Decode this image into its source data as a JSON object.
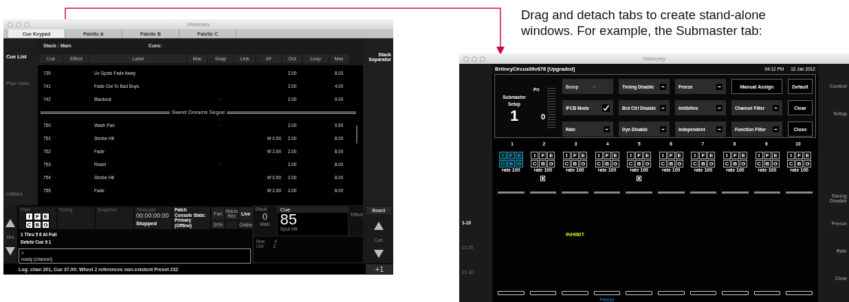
{
  "annotation": {
    "text": "Drag and detach tabs to create stand-alone windows. For example, the Submaster tab:"
  },
  "main_window": {
    "title": "Visionary",
    "tabs": [
      {
        "label": "Cue Keypad",
        "selected": true
      },
      {
        "label": "Palette A",
        "selected": false
      },
      {
        "label": "Palette B",
        "selected": false
      },
      {
        "label": "Palette C",
        "selected": false
      }
    ],
    "sidebar": [
      {
        "label": "Cue List",
        "selected": true
      },
      {
        "label": "Plan View",
        "selected": false
      },
      {
        "label": "Utilities",
        "selected": false
      }
    ],
    "stack_label": "Stack : Main",
    "cues_label": "Cues:",
    "right_label": "Stack Separator",
    "columns": [
      "Cue",
      "Effect",
      "Label",
      "Mac",
      "Snap",
      "Link",
      "AF",
      "Out",
      "Loop",
      "Max"
    ],
    "rows": [
      {
        "kind": "cue",
        "cue": "735",
        "label": "Uv Spots Fade Away",
        "out": "2.00",
        "max": "8.00"
      },
      {
        "kind": "cue",
        "cue": "741",
        "label": "Fade Out To Bad Boys",
        "out": "2.00",
        "max": "4.00"
      },
      {
        "kind": "cue",
        "cue": "742",
        "label": "Blackout",
        "snap": "·",
        "out": "2.00",
        "max": "9.00"
      },
      {
        "kind": "separator",
        "title": "Sweet Dreams Segue"
      },
      {
        "kind": "cue",
        "cue": "750",
        "label": "Wash Pan",
        "snap": "·",
        "out": "2.00",
        "max": "9.50"
      },
      {
        "kind": "cue",
        "cue": "751",
        "label": "Strobe Hit",
        "af": "W 0.50",
        "out": "2.00",
        "max": "8.00"
      },
      {
        "kind": "cue",
        "cue": "752",
        "label": "Fade",
        "af": "W 2.60",
        "out": "2.00",
        "max": "8.00"
      },
      {
        "kind": "cue",
        "cue": "753",
        "label": "Reset",
        "snap": "·",
        "out": "2.00",
        "max": "8.00"
      },
      {
        "kind": "cue",
        "cue": "754",
        "label": "Strobe Hit",
        "af": "W 0.50",
        "out": "2.00",
        "max": "8.00"
      },
      {
        "kind": "cue",
        "cue": "755",
        "label": "Fade",
        "af": "W 2.60",
        "out": "2.00",
        "max": "8.00"
      }
    ],
    "bottom": {
      "history_label": "Hist",
      "tiles": [
        {
          "kind": "filter",
          "label": "Filter",
          "flags": [
            "I",
            "F",
            "E",
            "C",
            "B",
            "G"
          ]
        },
        {
          "kind": "plain",
          "label": "Timing"
        },
        {
          "kind": "plain",
          "label": "Snapshot"
        },
        {
          "kind": "timecode",
          "label": "Timecode",
          "value": "00:00:00:00",
          "status": "Stopped"
        },
        {
          "kind": "patch",
          "lines": [
            "Patch",
            "Console State:",
            "Primary",
            "(Offline)"
          ]
        }
      ],
      "mode_buttons": [
        {
          "kind": "button",
          "label": "Part",
          "selected": false
        },
        {
          "kind": "button",
          "label": "Macro Rec",
          "selected": false
        },
        {
          "kind": "button",
          "label": "Live",
          "selected": true
        },
        {
          "kind": "button",
          "label": "SFth",
          "selected": false
        },
        {
          "kind": "blank"
        },
        {
          "kind": "button",
          "label": "Online",
          "selected": false
        }
      ],
      "history": [
        "1 Thru 5 6 At Full",
        "Delete Cue 9 1"
      ],
      "command": {
        "prompt": ">",
        "value": "ready (channel)"
      },
      "stack": {
        "label": "Stack",
        "value": "0",
        "name": "Main"
      },
      "cue": {
        "label": "Cue",
        "value": "85",
        "name": "Spot Hit"
      },
      "effect": {
        "label": "Effect"
      },
      "counts": [
        {
          "label": "Max",
          "value": "4"
        },
        {
          "label": "Out",
          "value": "2"
        }
      ],
      "board": {
        "label": "Board",
        "cue_label": "Cue"
      },
      "log": "Log: chan 201, Cue 37.00: Wheel 2 references non-existent Preset 232",
      "plus_button": "+1"
    }
  },
  "submaster_window": {
    "title": "Visionary",
    "show": "BritneyCircus09v676 [Upgraded]",
    "time": "04:12 PM",
    "date": "12 Jan 2012",
    "pages": [
      {
        "label": "1-10",
        "selected": true
      },
      {
        "label": "11-20",
        "selected": false
      },
      {
        "label": "21-30",
        "selected": false
      }
    ],
    "actions": [
      "Control",
      "Setup",
      "Timing Disable",
      "Freeze",
      "Rate",
      "Clear"
    ],
    "setup": {
      "title": "Submaster Setup",
      "number": "1",
      "priority_label": "Pri",
      "priority_value": "0",
      "controls": [
        {
          "kind": "toggle",
          "label": "Bump",
          "checked": false,
          "disabled": true
        },
        {
          "kind": "toggle",
          "label": "Timing Disable",
          "checked": false,
          "disabled": false
        },
        {
          "kind": "toggle",
          "label": "Freeze",
          "checked": false,
          "disabled": false
        },
        {
          "kind": "button",
          "label": "Manual Assign"
        },
        {
          "kind": "button",
          "label": "Default"
        },
        {
          "kind": "toggle",
          "label": "IFCB Mode",
          "checked": true,
          "disabled": false
        },
        {
          "kind": "toggle",
          "label": "Brd Ctrl Disable",
          "checked": false,
          "disabled": false
        },
        {
          "kind": "toggle",
          "label": "Inhibitive",
          "checked": false,
          "disabled": false
        },
        {
          "kind": "toggle",
          "label": "Channel Filter",
          "checked": false,
          "disabled": false
        },
        {
          "kind": "button",
          "label": "Clear"
        },
        {
          "kind": "toggle",
          "label": "Rate",
          "checked": false,
          "disabled": false
        },
        {
          "kind": "toggle",
          "label": "Dyn Disable",
          "checked": false,
          "disabled": false
        },
        {
          "kind": "toggle",
          "label": "Independent",
          "checked": false,
          "disabled": false
        },
        {
          "kind": "toggle",
          "label": "Function Filter",
          "checked": false,
          "disabled": false
        },
        {
          "kind": "button",
          "label": "Close"
        }
      ]
    },
    "submasters": [
      {
        "number": "1",
        "flags": [
          "I",
          "F",
          "E",
          "C",
          "B",
          "G"
        ],
        "selected": true,
        "rate": "rate 100",
        "marker": false
      },
      {
        "number": "2",
        "flags": [
          "I",
          "F",
          "E",
          "C",
          "B",
          "G"
        ],
        "selected": false,
        "rate": "rate 100",
        "marker": true
      },
      {
        "number": "3",
        "flags": [
          "I",
          "F",
          "E",
          "C",
          "B",
          "G"
        ],
        "selected": false,
        "rate": "rate 100",
        "marker": false,
        "status": "INHIBIT"
      },
      {
        "number": "4",
        "flags": [
          "I",
          "F",
          "E",
          "C",
          "B",
          "G"
        ],
        "selected": false,
        "rate": "rate 100",
        "marker": false,
        "footer": "Freeze"
      },
      {
        "number": "5",
        "flags": [
          "I",
          "F",
          "E",
          "C",
          "B",
          "G"
        ],
        "selected": false,
        "rate": "rate 100",
        "marker": true
      },
      {
        "number": "6",
        "flags": [
          "I",
          "F",
          "E",
          "C",
          "B",
          "G"
        ],
        "selected": false,
        "rate": "rate 100",
        "marker": false
      },
      {
        "number": "7",
        "flags": [
          "I",
          "F",
          "E",
          "C",
          "B",
          "G"
        ],
        "selected": false,
        "rate": "rate 100",
        "marker": false
      },
      {
        "number": "8",
        "flags": [
          "I",
          "F",
          "E",
          "C",
          "B",
          "G"
        ],
        "selected": false,
        "rate": "rate 100",
        "marker": false
      },
      {
        "number": "9",
        "flags": [
          "I",
          "F",
          "E",
          "C",
          "B",
          "G"
        ],
        "selected": false,
        "rate": "rate 100",
        "marker": false
      },
      {
        "number": "10",
        "flags": [
          "I",
          "F",
          "E",
          "C",
          "B",
          "G"
        ],
        "selected": false,
        "rate": "rate 100",
        "marker": false
      }
    ]
  }
}
